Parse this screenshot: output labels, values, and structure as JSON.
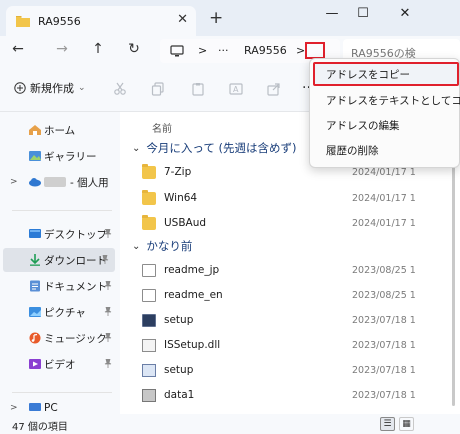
{
  "window": {
    "tab_title": "RA9556",
    "tab_close": "✕",
    "new_tab": "+",
    "minimize": "—",
    "maximize": "☐",
    "close": "✕"
  },
  "nav": {
    "back": "←",
    "forward": "→",
    "up": "↑",
    "refresh": "↻",
    "breadcrumb_sep": ">",
    "ellipsis": "···",
    "current_folder": "RA9556",
    "search_placeholder": "RA9556の検"
  },
  "toolbar": {
    "new_label": "新規作成",
    "new_caret": "⌄",
    "more": "···"
  },
  "sidebar": {
    "items": [
      {
        "label": "ホーム",
        "icon": "home-icon"
      },
      {
        "label": "ギャラリー",
        "icon": "gallery-icon"
      },
      {
        "label": "- 個人用",
        "icon": "cloud-icon",
        "expand": ">"
      },
      {
        "label": "デスクトップ",
        "icon": "desktop-icon",
        "pin": "📌"
      },
      {
        "label": "ダウンロード",
        "icon": "download-icon",
        "pin": "📌"
      },
      {
        "label": "ドキュメント",
        "icon": "documents-icon",
        "pin": "📌"
      },
      {
        "label": "ピクチャ",
        "icon": "pictures-icon",
        "pin": "📌"
      },
      {
        "label": "ミュージック",
        "icon": "music-icon",
        "pin": "📌"
      },
      {
        "label": "ビデオ",
        "icon": "video-icon",
        "pin": "📌"
      },
      {
        "label": "PC",
        "icon": "pc-icon",
        "expand": ">"
      }
    ]
  },
  "list": {
    "column_name": "名前",
    "groups": [
      {
        "title": "今月に入って (先週は含めず)",
        "chevron": "⌄",
        "files": [
          {
            "name": "7-Zip",
            "date": "2024/01/17 1",
            "type": "folder"
          },
          {
            "name": "Win64",
            "date": "2024/01/17 1",
            "type": "folder"
          },
          {
            "name": "USBAud",
            "date": "2024/01/17 1",
            "type": "folder"
          }
        ]
      },
      {
        "title": "かなり前",
        "chevron": "⌄",
        "files": [
          {
            "name": "readme_jp",
            "date": "2023/08/25 1",
            "type": "doc"
          },
          {
            "name": "readme_en",
            "date": "2023/08/25 1",
            "type": "doc"
          },
          {
            "name": "setup",
            "date": "2023/07/18 1",
            "type": "exe"
          },
          {
            "name": "ISSetup.dll",
            "date": "2023/07/18 1",
            "type": "dll"
          },
          {
            "name": "setup",
            "date": "2023/07/18 1",
            "type": "setup"
          },
          {
            "name": "data1",
            "date": "2023/07/18 1",
            "type": "data"
          }
        ]
      }
    ]
  },
  "status": {
    "count_text": "47 個の項目",
    "details_view": "☰",
    "tiles_view": "▦"
  },
  "context_menu": {
    "items": [
      "アドレスをコピー",
      "アドレスをテキストとしてコピー",
      "アドレスの編集",
      "履歴の削除"
    ],
    "highlight_color": "#e0202c"
  }
}
